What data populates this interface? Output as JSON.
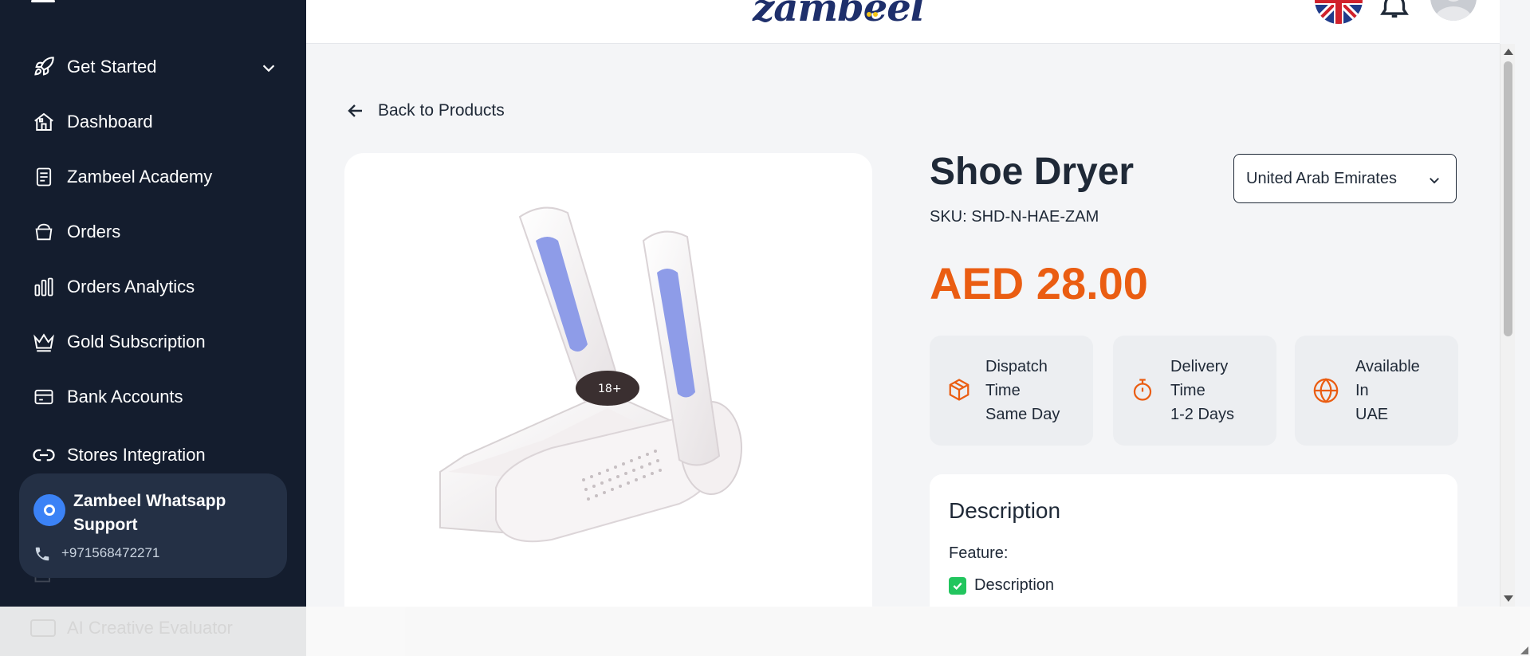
{
  "sidebar": {
    "items": [
      {
        "label": "Get Started",
        "icon": "rocket-icon"
      },
      {
        "label": "Dashboard",
        "icon": "home-icon"
      },
      {
        "label": "Zambeel Academy",
        "icon": "book-icon"
      },
      {
        "label": "Orders",
        "icon": "basket-icon"
      },
      {
        "label": "Orders Analytics",
        "icon": "bar-chart-icon"
      },
      {
        "label": "Gold Subscription",
        "icon": "crown-icon"
      },
      {
        "label": "Bank Accounts",
        "icon": "card-icon"
      },
      {
        "label": "Stores Integration",
        "icon": "link-icon"
      }
    ],
    "hidden_item": "AI Creative Evaluator",
    "support": {
      "title": "Zambeel Whatsapp Support",
      "phone": "+971568472271"
    }
  },
  "header": {
    "logo_text": "zambeel"
  },
  "product": {
    "back_label": "Back to Products",
    "title": "Shoe Dryer",
    "sku": "SKU: SHD-N-HAE-ZAM",
    "price": "AED 28.00",
    "country": "United Arab Emirates",
    "info_cards": [
      {
        "line1": "Dispatch",
        "line2": "Time",
        "value": "Same Day",
        "icon": "box-icon"
      },
      {
        "line1": "Delivery",
        "line2": "Time",
        "value": "1-2 Days",
        "icon": "stopwatch-icon"
      },
      {
        "line1": "Available",
        "line2": "In",
        "value": "UAE",
        "icon": "globe-icon"
      }
    ],
    "description": {
      "title": "Description",
      "feature_label": "Feature:",
      "first_line": "Description"
    }
  },
  "colors": {
    "sidebar_bg": "#141d2e",
    "accent_orange": "#ea5d12",
    "support_blue": "#3b82f6"
  }
}
